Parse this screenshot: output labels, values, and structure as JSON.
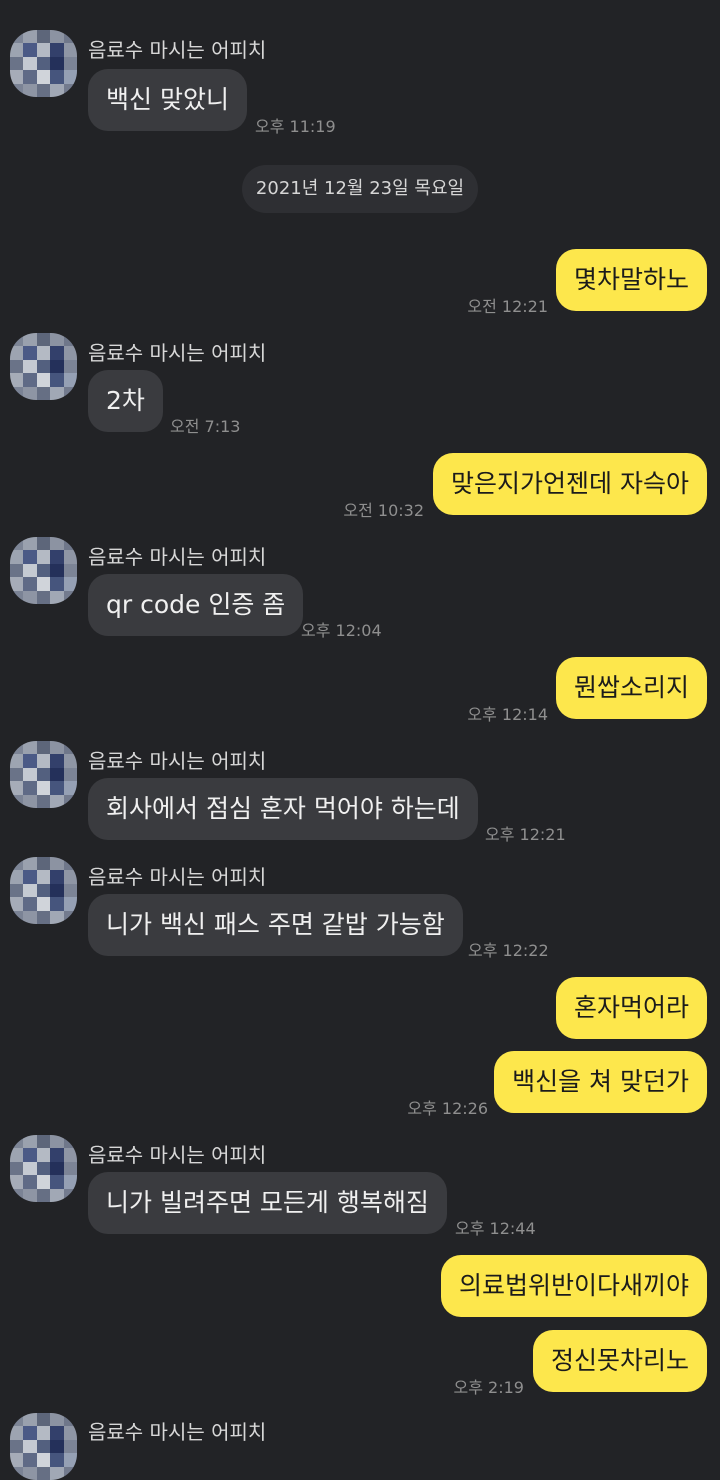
{
  "chat": {
    "sender_name": "음료수 마시는 어피치",
    "date_divider": "2021년 12월 23일 목요일",
    "messages": [
      {
        "text": "백신 맞았니",
        "time": "오후 11:19"
      },
      {
        "text": "몇차말하노",
        "time": "오전 12:21"
      },
      {
        "text": "2차",
        "time": "오전 7:13"
      },
      {
        "text": "맞은지가언젠데 자슥아",
        "time": "오전 10:32"
      },
      {
        "text": "qr code 인증 좀",
        "time": "오후 12:04"
      },
      {
        "text": "뭔쌉소리지",
        "time": "오후 12:14"
      },
      {
        "text": "회사에서 점심 혼자 먹어야 하는데",
        "time": "오후 12:21"
      },
      {
        "text": "니가 백신 패스 주면 같밥 가능함",
        "time": "오후 12:22"
      },
      {
        "text": "혼자먹어라",
        "time": ""
      },
      {
        "text": "백신을 쳐 맞던가",
        "time": "오후 12:26"
      },
      {
        "text": "니가 빌려주면 모든게 행복해짐",
        "time": "오후 12:44"
      },
      {
        "text": "의료법위반이다새끼야",
        "time": ""
      },
      {
        "text": "정신못차리노",
        "time": "오후 2:19"
      }
    ]
  },
  "colors": {
    "background": "#222326",
    "incoming_bubble": "#3a3b3f",
    "outgoing_bubble": "#fde74c"
  }
}
